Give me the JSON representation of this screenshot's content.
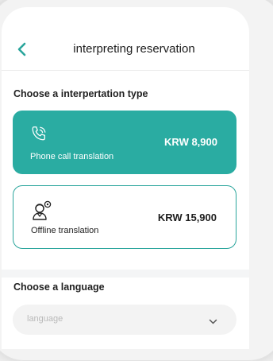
{
  "header": {
    "title": "interpreting reservation"
  },
  "interpretation": {
    "title": "Choose a interpertation type",
    "options": [
      {
        "label": "Phone call translation",
        "price": "KRW 8,900",
        "icon": "phone-ringing-icon",
        "selected": true
      },
      {
        "label": "Offline translation",
        "price": "KRW 15,900",
        "icon": "interpreter-person-icon",
        "selected": false
      }
    ]
  },
  "language": {
    "title": "Choose a language",
    "placeholder": "language",
    "icon": "chevron-down-icon"
  },
  "colors": {
    "accent": "#2aaca2",
    "border": "#2aa59c",
    "background": "#f4f5f6"
  }
}
